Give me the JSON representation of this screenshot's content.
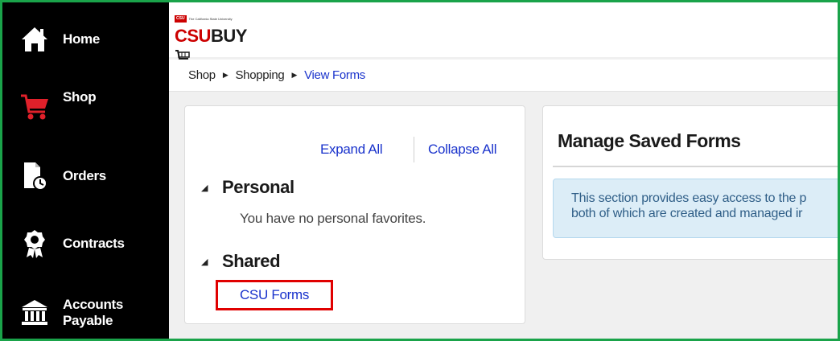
{
  "sidebar": {
    "items": [
      {
        "label": "Home",
        "icon": "home-icon"
      },
      {
        "label": "Shop",
        "icon": "cart-icon"
      },
      {
        "label": "Orders",
        "icon": "orders-icon"
      },
      {
        "label": "Contracts",
        "icon": "contracts-icon"
      },
      {
        "label": "Accounts\nPayable",
        "icon": "bank-icon"
      }
    ]
  },
  "header": {
    "logo_badge": "CSU",
    "logo_small_text": "The California State University",
    "logo_csu": "CSU",
    "logo_buy": "BUY"
  },
  "breadcrumb": {
    "items": [
      "Shop",
      "Shopping",
      "View Forms"
    ]
  },
  "favorites": {
    "expand_all": "Expand All",
    "collapse_all": "Collapse All",
    "personal_title": "Personal",
    "personal_empty": "You have no personal favorites.",
    "shared_title": "Shared",
    "shared_item": "CSU Forms"
  },
  "main": {
    "title": "Manage Saved Forms",
    "info_line1": "This section provides easy access to the p",
    "info_line2": "both of which are created and managed ir"
  },
  "colors": {
    "accent_link": "#1a33cc",
    "brand_red": "#cc0000",
    "highlight_box": "#e00000",
    "frame_green": "#1aa34a",
    "info_bg": "#dcedf7"
  }
}
